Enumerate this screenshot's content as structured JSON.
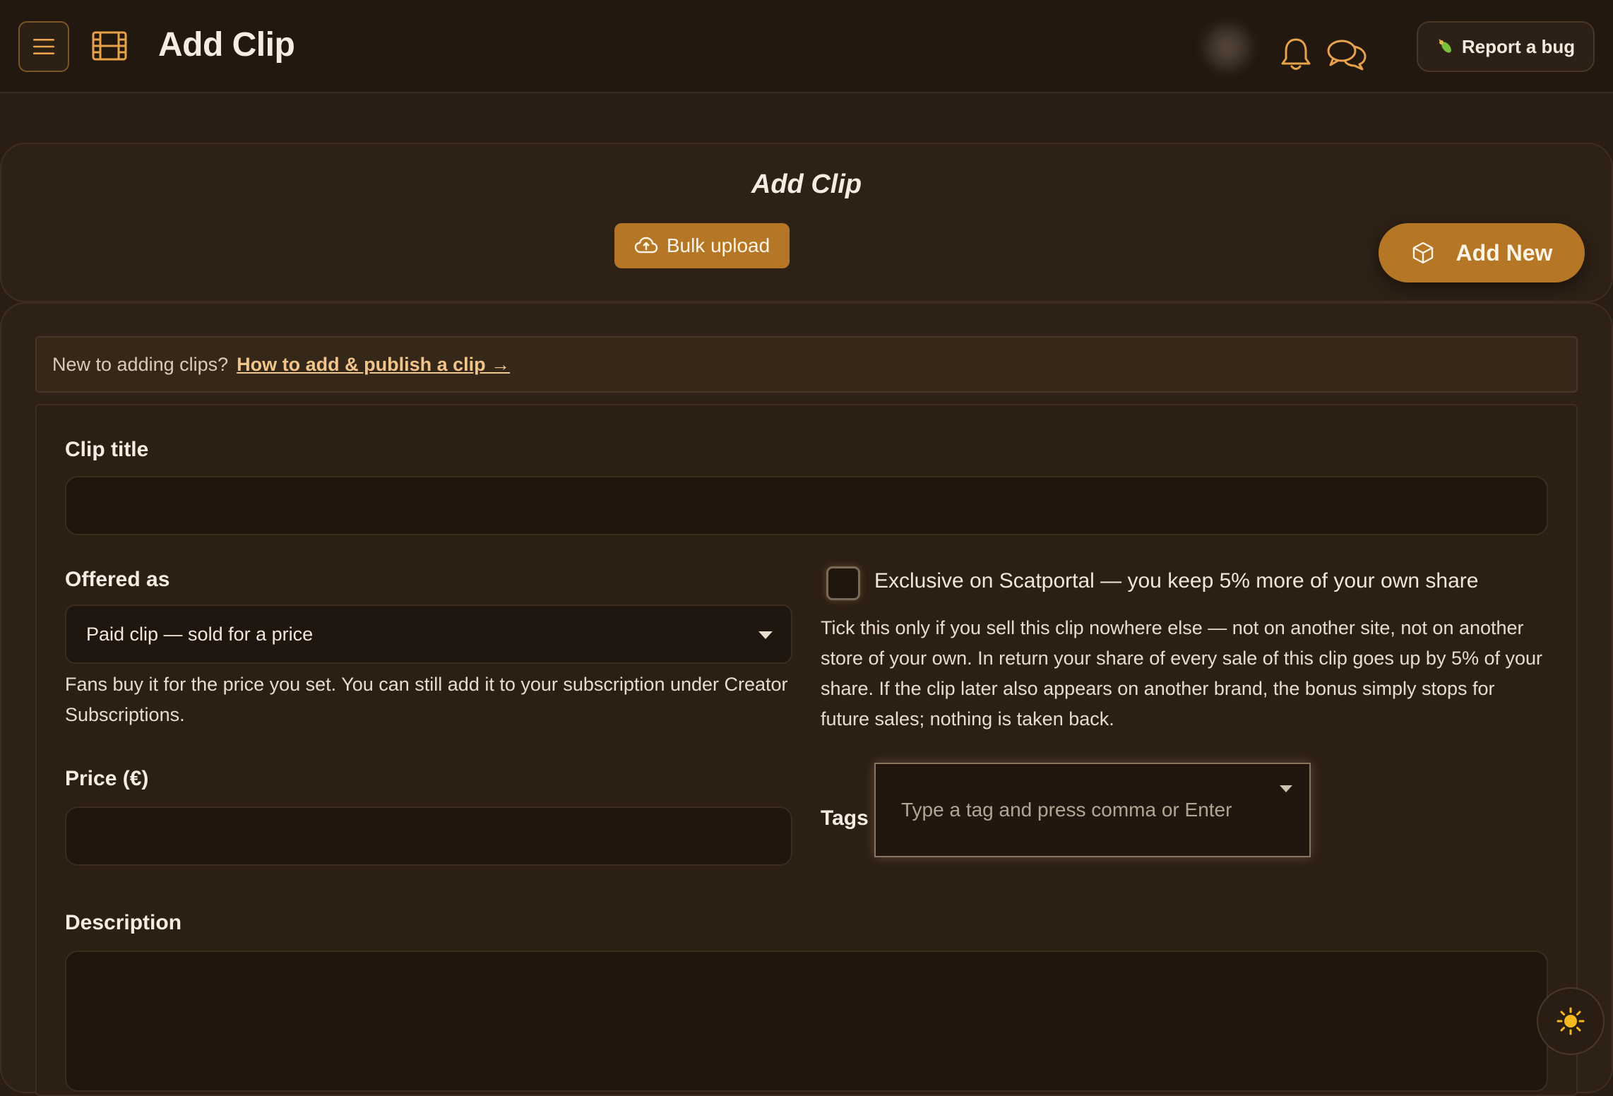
{
  "topbar": {
    "title": "Add Clip",
    "report_bug_label": "Report a bug",
    "icons": [
      "menu-icon",
      "film-icon",
      "avatar",
      "bell-icon",
      "chat-icon",
      "bug-icon"
    ]
  },
  "header": {
    "title": "Add Clip",
    "bulk_upload_label": "Bulk upload",
    "add_new_label": "Add New"
  },
  "help_banner": {
    "text": "New to adding clips?",
    "link_text": "How to add & publish a clip →"
  },
  "form": {
    "clip_title": {
      "label": "Clip title",
      "value": ""
    },
    "offered_as": {
      "label": "Offered as",
      "selected": "Paid clip — sold for a price",
      "help": "Fans buy it for the price you set. You can still add it to your subscription under Creator Subscriptions."
    },
    "exclusive": {
      "checked": false,
      "label": "Exclusive on Scatportal — you keep 5% more of your own share",
      "help": "Tick this only if you sell this clip nowhere else — not on another site, not on another store of your own. In return your share of every sale of this clip goes up by 5% of your share. If the clip later also appears on another brand, the bonus simply stops for future sales; nothing is taken back."
    },
    "price": {
      "label": "Price (€)",
      "value": ""
    },
    "tags": {
      "label": "Tags",
      "placeholder": "Type a tag and press comma or Enter"
    },
    "description": {
      "label": "Description",
      "value": ""
    }
  },
  "colors": {
    "accent": "#b57626",
    "background": "#2a1d13",
    "link": "#f0c48a"
  },
  "theme_toggle_icon": "sun-icon"
}
